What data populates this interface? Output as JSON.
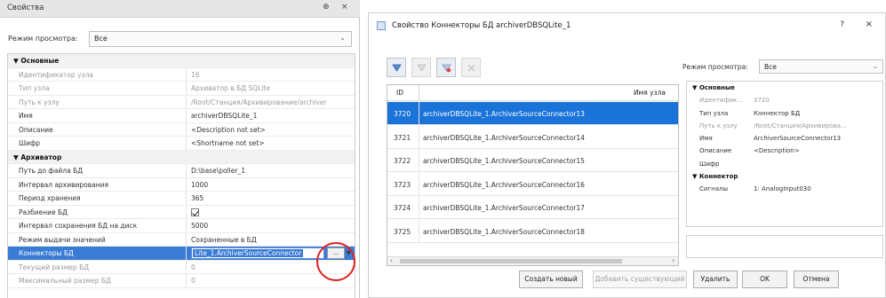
{
  "left_panel": {
    "title": "Свойства",
    "pin_icon": "pin-icon",
    "close_label": "×",
    "pin_label": "⊕",
    "view_mode_label": "Режим просмотра:",
    "view_mode_value": "Все",
    "groups": [
      {
        "name": "Основные",
        "rows": [
          {
            "key": "Идентификатор узла",
            "value": "16",
            "disabled": true
          },
          {
            "key": "Тип узла",
            "value": "Архиватор в БД SQLite",
            "disabled": true
          },
          {
            "key": "Путь к узлу",
            "value": "/Root/Станция/Архивирование/archiver",
            "disabled": true
          },
          {
            "key": "Имя",
            "value": "archiverDBSQLite_1",
            "disabled": false
          },
          {
            "key": "Описание",
            "value": "<Description not set>",
            "disabled": false
          },
          {
            "key": "Шифр",
            "value": "<Shortname not set>",
            "disabled": false
          }
        ]
      },
      {
        "name": "Архиватор",
        "rows": [
          {
            "key": "Путь до файла БД",
            "value": "D:\\base\\poller_1",
            "disabled": false
          },
          {
            "key": "Интервал архивирования",
            "value": "1000",
            "disabled": false
          },
          {
            "key": "Период хранения",
            "value": "365",
            "disabled": false
          },
          {
            "key": "Разбиение БД",
            "value": "",
            "checkbox": true,
            "disabled": false
          },
          {
            "key": "Интервал сохранения БД на диск",
            "value": "5000",
            "disabled": false
          },
          {
            "key": "Режим выдачи значений",
            "value": "Сохраненные в БД",
            "disabled": false
          },
          {
            "key": "Коннекторы БД",
            "value": "Lite_1.ArchiverSourceConnector",
            "selected": true,
            "disabled": false
          },
          {
            "key": "Текущий размер БД",
            "value": "0",
            "disabled": true
          },
          {
            "key": "Максимальный размер БД",
            "value": "0",
            "disabled": true
          }
        ]
      }
    ],
    "ellipsis_label": "...",
    "dropdown_glyph": "▼"
  },
  "dialog": {
    "title": "Свойство Коннекторы БД archiverDBSQLite_1",
    "help_label": "?",
    "close_label": "×",
    "toolbar": [
      {
        "name": "add-connector-icon",
        "enabled": true
      },
      {
        "name": "copy-connector-icon",
        "enabled": false
      },
      {
        "name": "delete-connector-icon",
        "enabled": true
      },
      {
        "name": "tools-icon",
        "enabled": false
      }
    ],
    "list": {
      "col_id": "ID",
      "col_name": "Имя узла",
      "rows": [
        {
          "id": "3720",
          "name": "archiverDBSQLite_1.ArchiverSourceConnector13",
          "selected": true
        },
        {
          "id": "3721",
          "name": "archiverDBSQLite_1.ArchiverSourceConnector14",
          "selected": false
        },
        {
          "id": "3722",
          "name": "archiverDBSQLite_1.ArchiverSourceConnector15",
          "selected": false
        },
        {
          "id": "3723",
          "name": "archiverDBSQLite_1.ArchiverSourceConnector16",
          "selected": false
        },
        {
          "id": "3724",
          "name": "archiverDBSQLite_1.ArchiverSourceConnector17",
          "selected": false
        },
        {
          "id": "3725",
          "name": "archiverDBSQLite_1.ArchiverSourceConnector18",
          "selected": false
        }
      ],
      "scroll_left": "‹",
      "scroll_right": "›"
    },
    "view_mode_label": "Режим просмотра:",
    "view_mode_value": "Все",
    "props": [
      {
        "key": "Основные",
        "value": "",
        "group": true
      },
      {
        "key": "Идентифик...",
        "value": "3720",
        "disabled": true
      },
      {
        "key": "Тип узла",
        "value": "Коннектор БД",
        "disabled": false
      },
      {
        "key": "Путь к узлу",
        "value": "/Root/Станция/Архивирова...",
        "disabled": true
      },
      {
        "key": "Имя",
        "value": "ArchiverSourceConnector13",
        "disabled": false
      },
      {
        "key": "Описание",
        "value": "<Description>",
        "disabled": false
      },
      {
        "key": "Шифр",
        "value": "",
        "disabled": false
      },
      {
        "key": "Коннектор",
        "value": "",
        "group": true
      },
      {
        "key": "Сигналы",
        "value": "1: AnalogInput030",
        "disabled": false
      }
    ],
    "buttons": [
      {
        "label": "Создать новый",
        "enabled": true
      },
      {
        "label": "Добавить существующий",
        "enabled": false
      },
      {
        "label": "Удалить",
        "enabled": true
      },
      {
        "label": "OK",
        "enabled": true
      },
      {
        "label": "Отмена",
        "enabled": true
      }
    ]
  },
  "colors": {
    "selection": "#1a73d9",
    "highlight_circle": "#e02020"
  }
}
